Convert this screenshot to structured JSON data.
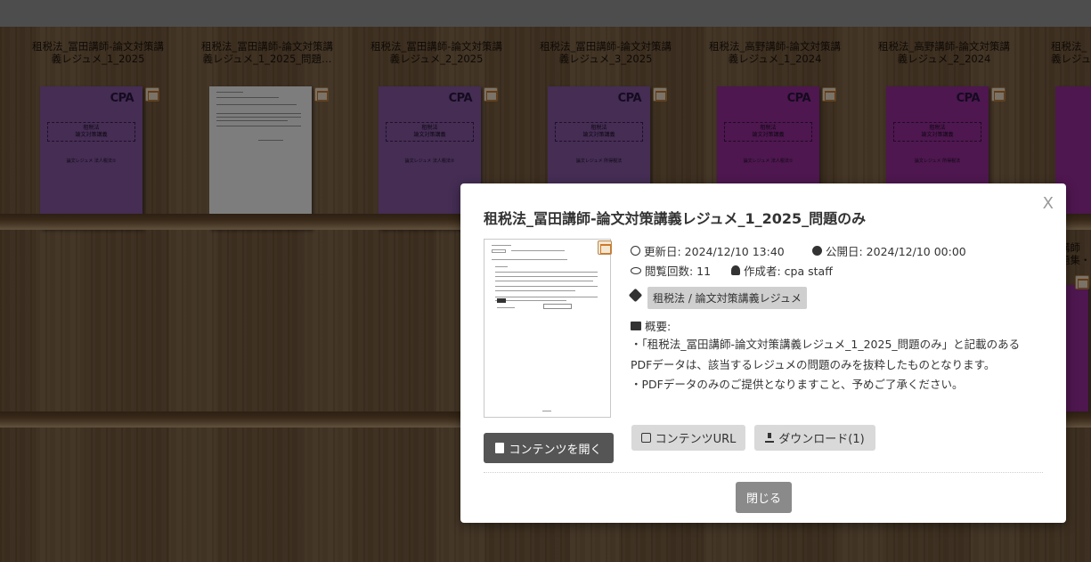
{
  "shelf": {
    "books": [
      {
        "title": "租税法_冨田講師-論文対策講\n義レジュメ_1_2025",
        "cover": "purple",
        "cover_text": {
          "subject": "租税法",
          "course": "論文対策講義",
          "subtitle": "論文レジュメ 法人税法①",
          "brand": "CPA"
        }
      },
      {
        "title": "租税法_冨田講師-論文対策講\n義レジュメ_1_2025_問題…",
        "cover": "white"
      },
      {
        "title": "租税法_冨田講師-論文対策講\n義レジュメ_2_2025",
        "cover": "purple",
        "cover_text": {
          "subject": "租税法",
          "course": "論文対策講義",
          "subtitle": "論文レジュメ 法人税法②",
          "brand": "CPA"
        }
      },
      {
        "title": "租税法_冨田講師-論文対策講\n義レジュメ_3_2025",
        "cover": "purple",
        "cover_text": {
          "subject": "租税法",
          "course": "論文対策講義",
          "subtitle": "論文レジュメ 所得税法",
          "brand": "CPA"
        }
      },
      {
        "title": "租税法_高野講師-論文対策講\n義レジュメ_1_2024",
        "cover": "magenta",
        "cover_text": {
          "subject": "租税法",
          "course": "論文対策講義",
          "subtitle": "論文レジュメ 法人税法①",
          "brand": "CPA"
        }
      },
      {
        "title": "租税法_高野講師-論文対策講\n義レジュメ_2_2024",
        "cover": "magenta",
        "cover_text": {
          "subject": "租税法",
          "course": "論文対策講義",
          "subtitle": "論文レジュメ 所得税法",
          "brand": "CPA"
        }
      },
      {
        "title": "租税法_\n義レジュ",
        "cover": "magenta"
      }
    ],
    "row2_partial_title": "講師\n題集・"
  },
  "modal": {
    "title": "租税法_冨田講師-論文対策講義レジュメ_1_2025_問題のみ",
    "close_x": "X",
    "updated": "更新日: 2024/12/10 13:40",
    "published": "公開日: 2024/12/10 00:00",
    "views": "閲覧回数: 11",
    "author": "作成者: cpa staff",
    "tag": "租税法 / 論文対策講義レジュメ",
    "summary_label": "概要:",
    "summary_lines": [
      "・「租税法_冨田講師-論文対策講義レジュメ_1_2025_問題のみ」と記載のあるPDFデータは、該当するレジュメの問題のみを抜粋したものとなります。",
      "・PDFデータのみのご提供となりますこと、予めご了承ください。"
    ],
    "open_button": "コンテンツを開く",
    "url_button": "コンテンツURL",
    "download_button": "ダウンロード(1)",
    "close_button": "閉じる"
  },
  "colors": {
    "purple_cover": "#8b5aa8",
    "magenta_cover": "#9c2f9e",
    "open_button": "#555555",
    "close_button": "#8a8a8a"
  }
}
